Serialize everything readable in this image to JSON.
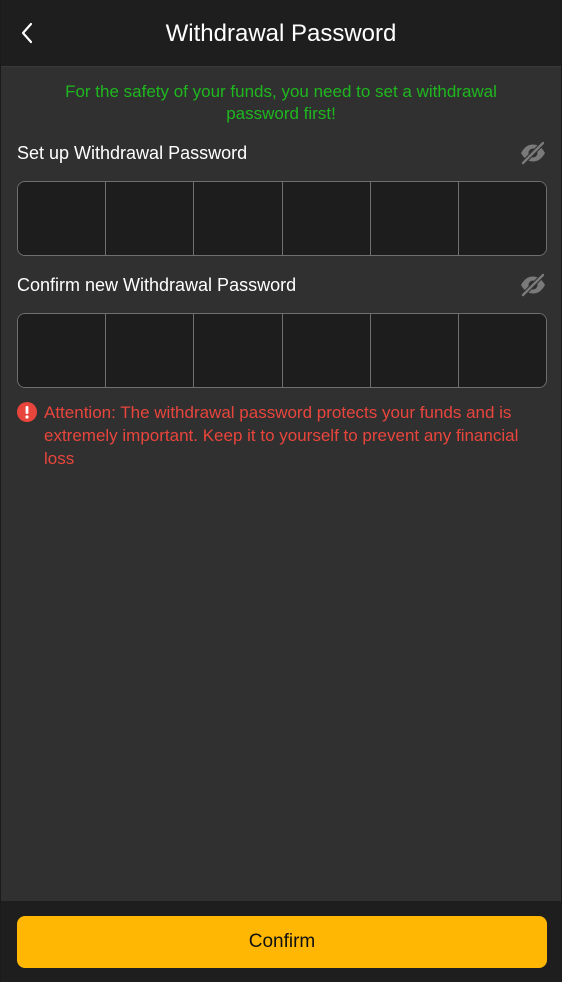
{
  "header": {
    "title": "Withdrawal Password",
    "back_icon": "chevron-left-icon"
  },
  "notice": "For the safety of your funds, you need to set a withdrawal password first!",
  "password_field": {
    "label": "Set up Withdrawal Password",
    "visibility_icon": "eye-off-icon",
    "digit_count": 6
  },
  "confirm_field": {
    "label": "Confirm new Withdrawal Password",
    "visibility_icon": "eye-off-icon",
    "digit_count": 6
  },
  "attention": {
    "icon": "exclamation-circle-icon",
    "text": "Attention: The withdrawal password protects your funds and is extremely important. Keep it to yourself to prevent any financial loss"
  },
  "footer": {
    "confirm_label": "Confirm"
  },
  "colors": {
    "accent": "#ffb703",
    "notice": "#1fb71f",
    "warning": "#e8453c",
    "background": "#303030",
    "header": "#1e1e1e"
  }
}
